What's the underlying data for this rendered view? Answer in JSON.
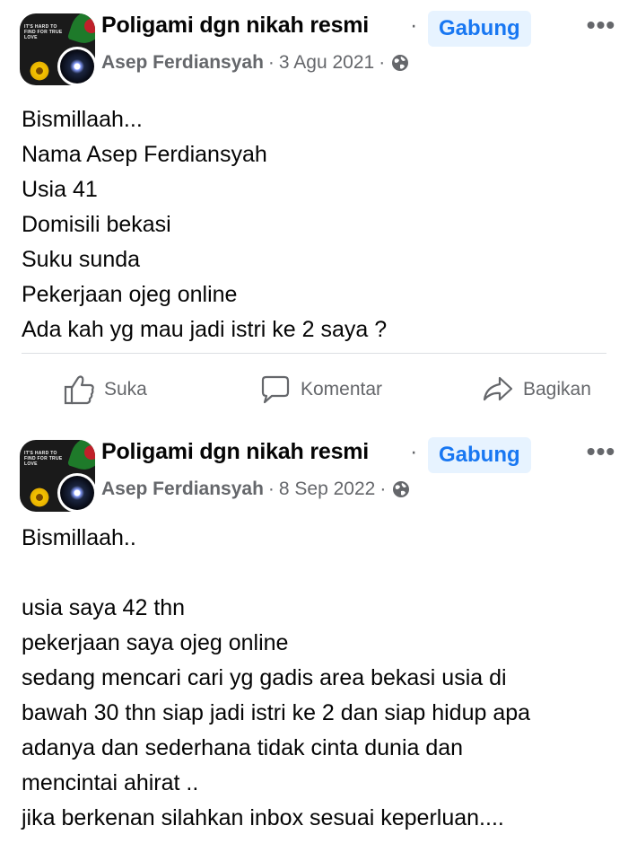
{
  "posts": [
    {
      "group_name": "Poligami dgn nikah resmi",
      "dot": "·",
      "join_label": "Gabung",
      "more_label": "•••",
      "author": "Asep Ferdiansyah",
      "sep": "·",
      "date": "3 Agu 2021",
      "privacy_icon": "globe-icon",
      "lines": [
        "Bismillaah...",
        "Nama Asep Ferdiansyah",
        "Usia 41",
        "Domisili bekasi",
        "Suku sunda",
        "Pekerjaan ojeg online",
        "Ada kah yg mau jadi istri ke 2 saya ?"
      ]
    },
    {
      "group_name": "Poligami dgn nikah resmi",
      "dot": "·",
      "join_label": "Gabung",
      "more_label": "•••",
      "author": "Asep Ferdiansyah",
      "sep": "·",
      "date": "8 Sep 2022",
      "privacy_icon": "globe-icon",
      "lines": [
        "Bismillaah..",
        "",
        "usia saya 42 thn",
        "pekerjaan saya ojeg online",
        "sedang mencari cari yg gadis area bekasi usia di",
        "bawah 30 thn siap jadi istri ke 2 dan siap hidup apa",
        "adanya dan sederhana tidak cinta dunia dan",
        "mencintai ahirat ..",
        "jika berkenan silahkan inbox sesuai keperluan...."
      ]
    }
  ],
  "actions": {
    "like_label": "Suka",
    "like_icon": "thumbs-up-icon",
    "comment_label": "Komentar",
    "comment_icon": "comment-icon",
    "share_label": "Bagikan",
    "share_icon": "share-icon"
  },
  "group_avatar_text": "IT'S HARD TO FIND FOR TRUE LOVE",
  "colors": {
    "join_bg": "#e7f3ff",
    "join_text": "#1877f2",
    "meta_text": "#65676b",
    "body_text": "#050505"
  }
}
